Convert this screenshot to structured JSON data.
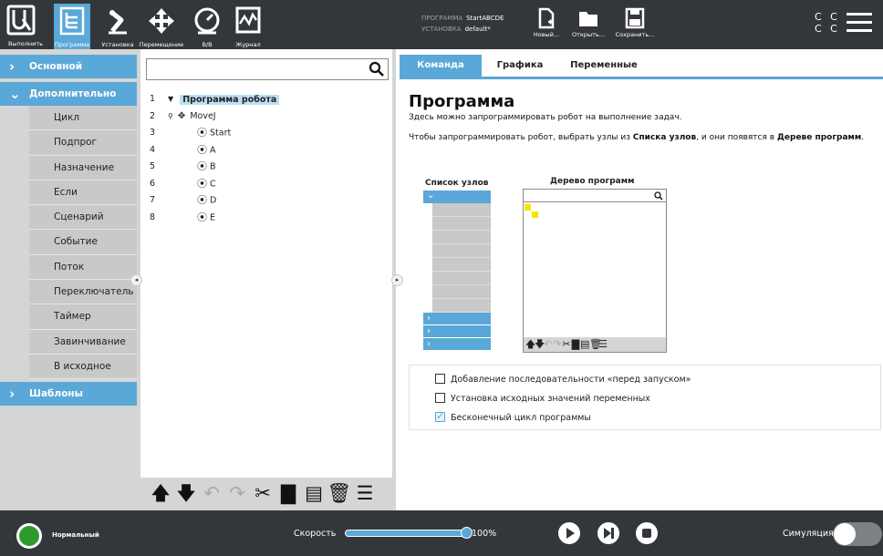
{
  "colors": {
    "accent": "#5aa8d8",
    "dark": "#33373b",
    "panel": "#d5d5d5",
    "status_ok": "#2e9a2e"
  },
  "topbar": {
    "nav": [
      {
        "label": "Выполнить",
        "icon": "ur-logo-icon"
      },
      {
        "label": "Программа",
        "icon": "program-icon",
        "active": true
      },
      {
        "label": "Установка",
        "icon": "installation-robot-arm-icon"
      },
      {
        "label": "Перемещение",
        "icon": "move-arrows-icon"
      },
      {
        "label": "В/В",
        "icon": "io-gauge-icon"
      },
      {
        "label": "Журнал",
        "icon": "log-chart-icon"
      }
    ],
    "program_label": "ПРОГРАММА",
    "program_value": "StartABCDE",
    "installation_label": "УСТАНОВКА",
    "installation_value": "default*",
    "file_buttons": [
      "Новый...",
      "Открыть...",
      "Сохранить..."
    ],
    "cc": [
      "C C",
      "C C"
    ]
  },
  "leftnav": {
    "sections": [
      "Основной",
      "Дополнительно",
      "Шаблоны"
    ],
    "items": [
      "Цикл",
      "Подпрог",
      "Назначение",
      "Если",
      "Сценарий",
      "Событие",
      "Поток",
      "Переключатель",
      "Таймер",
      "Завинчивание",
      "В исходное"
    ]
  },
  "tree": {
    "search_value": "",
    "rows": [
      {
        "num": "1",
        "label": "Программа робота"
      },
      {
        "num": "2",
        "label": "MoveJ"
      },
      {
        "num": "3",
        "label": "Start"
      },
      {
        "num": "4",
        "label": "A"
      },
      {
        "num": "5",
        "label": "B"
      },
      {
        "num": "6",
        "label": "C"
      },
      {
        "num": "7",
        "label": "D"
      },
      {
        "num": "8",
        "label": "E"
      }
    ]
  },
  "right": {
    "tabs": [
      "Команда",
      "Графика",
      "Переменные"
    ],
    "title": "Программа",
    "desc": "Здесь можно запрограммировать робот на выполнение задач.",
    "help_pre": "Чтобы запрограммировать робот, выбрать узлы из ",
    "help_b1": "Списка узлов",
    "help_mid": ", и они появятся в ",
    "help_b2": "Дереве программ",
    "help_end": ".",
    "nodelist_title": "Список узлов",
    "programtree_title": "Дерево программ",
    "options": [
      {
        "label": "Добавление последовательности «перед запуском»",
        "checked": false
      },
      {
        "label": "Установка исходных значений переменных",
        "checked": false
      },
      {
        "label": "Бесконечный цикл программы",
        "checked": true
      }
    ]
  },
  "bottom": {
    "status": "Нормальный",
    "speed_label": "Скорость",
    "speed_value": "100%",
    "speed_fraction": 1.0,
    "sim_label": "Симуляция"
  }
}
